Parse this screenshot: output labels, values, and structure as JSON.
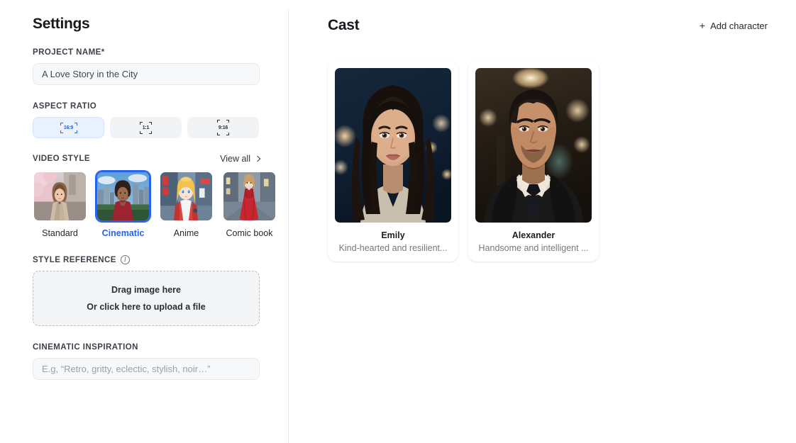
{
  "settings": {
    "title": "Settings",
    "project_name": {
      "label": "PROJECT NAME*",
      "value": "A Love Story in the City"
    },
    "aspect_ratio": {
      "label": "ASPECT RATIO",
      "options": [
        {
          "label": "16:9",
          "selected": true
        },
        {
          "label": "1:1",
          "selected": false
        },
        {
          "label": "9:16",
          "selected": false
        }
      ]
    },
    "video_style": {
      "label": "VIDEO STYLE",
      "view_all_label": "View all",
      "view_all_icon": "chevron-right-icon",
      "options": [
        {
          "label": "Standard",
          "selected": false
        },
        {
          "label": "Cinematic",
          "selected": true
        },
        {
          "label": "Anime",
          "selected": false
        },
        {
          "label": "Comic book",
          "selected": false
        }
      ]
    },
    "style_reference": {
      "label": "STYLE REFERENCE",
      "info_icon": "info-icon",
      "drop_title": "Drag image here",
      "drop_subtitle": "Or click here to upload a file"
    },
    "cinematic_inspiration": {
      "label": "CINEMATIC INSPIRATION",
      "placeholder": "E.g, “Retro, gritty, eclectic, stylish, noir…”",
      "value": ""
    }
  },
  "cast": {
    "title": "Cast",
    "add_character_label": "Add character",
    "add_character_icon": "plus-icon",
    "characters": [
      {
        "name": "Emily",
        "description": "Kind-hearted and resilient..."
      },
      {
        "name": "Alexander",
        "description": "Handsome and intelligent ..."
      }
    ]
  },
  "colors": {
    "accent": "#2563eb",
    "accent_bg": "#e9f1fe",
    "text_primary": "#16191d",
    "text_muted": "#737980",
    "input_bg": "#f7f8f9",
    "panel_border": "#e9ebee"
  }
}
